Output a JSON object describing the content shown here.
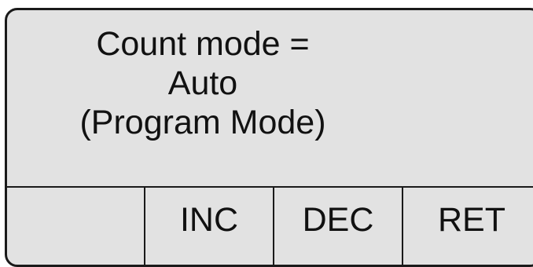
{
  "display": {
    "lines": [
      "Count mode =",
      "Auto",
      "(Program Mode)"
    ]
  },
  "softkeys": [
    {
      "label": ""
    },
    {
      "label": "INC"
    },
    {
      "label": "DEC"
    },
    {
      "label": "RET"
    }
  ],
  "colors": {
    "background": "#e2e2e2",
    "border": "#1a1a1a",
    "text": "#111111"
  }
}
